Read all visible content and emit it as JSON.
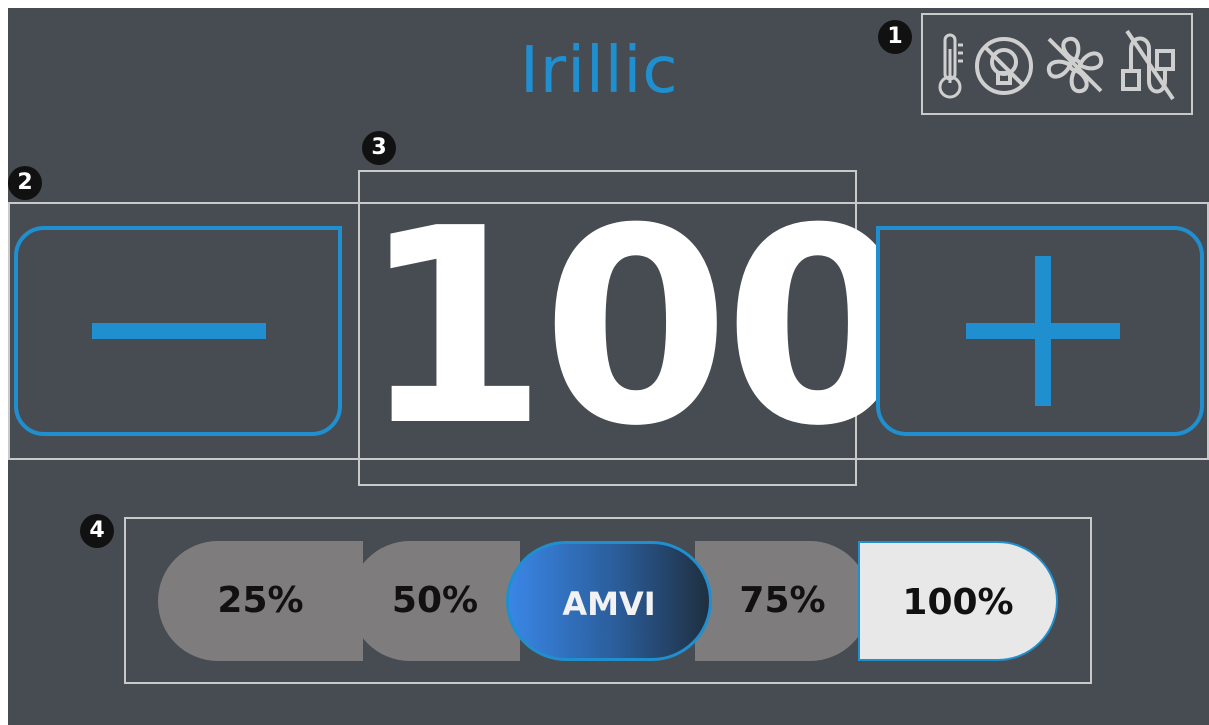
{
  "brand": "Irillic",
  "callouts": [
    "1",
    "2",
    "3",
    "4"
  ],
  "status_icons": {
    "thermometer": "thermometer-icon",
    "light_off": "light-off-icon",
    "fan_off": "fan-off-icon",
    "cable_off": "cable-off-icon"
  },
  "stepper": {
    "value": "100",
    "minus_icon": "minus-icon",
    "plus_icon": "plus-icon"
  },
  "presets": [
    {
      "label": "25%"
    },
    {
      "label": "50%"
    },
    {
      "label": "AMVI"
    },
    {
      "label": "75%"
    },
    {
      "label": "100%",
      "selected": true
    }
  ],
  "colors": {
    "background": "#474c52",
    "accent": "#1f8fcf",
    "text": "#ffffff",
    "preset_gray": "#7f7c7e",
    "preset_selected": "#e8e8e8"
  }
}
